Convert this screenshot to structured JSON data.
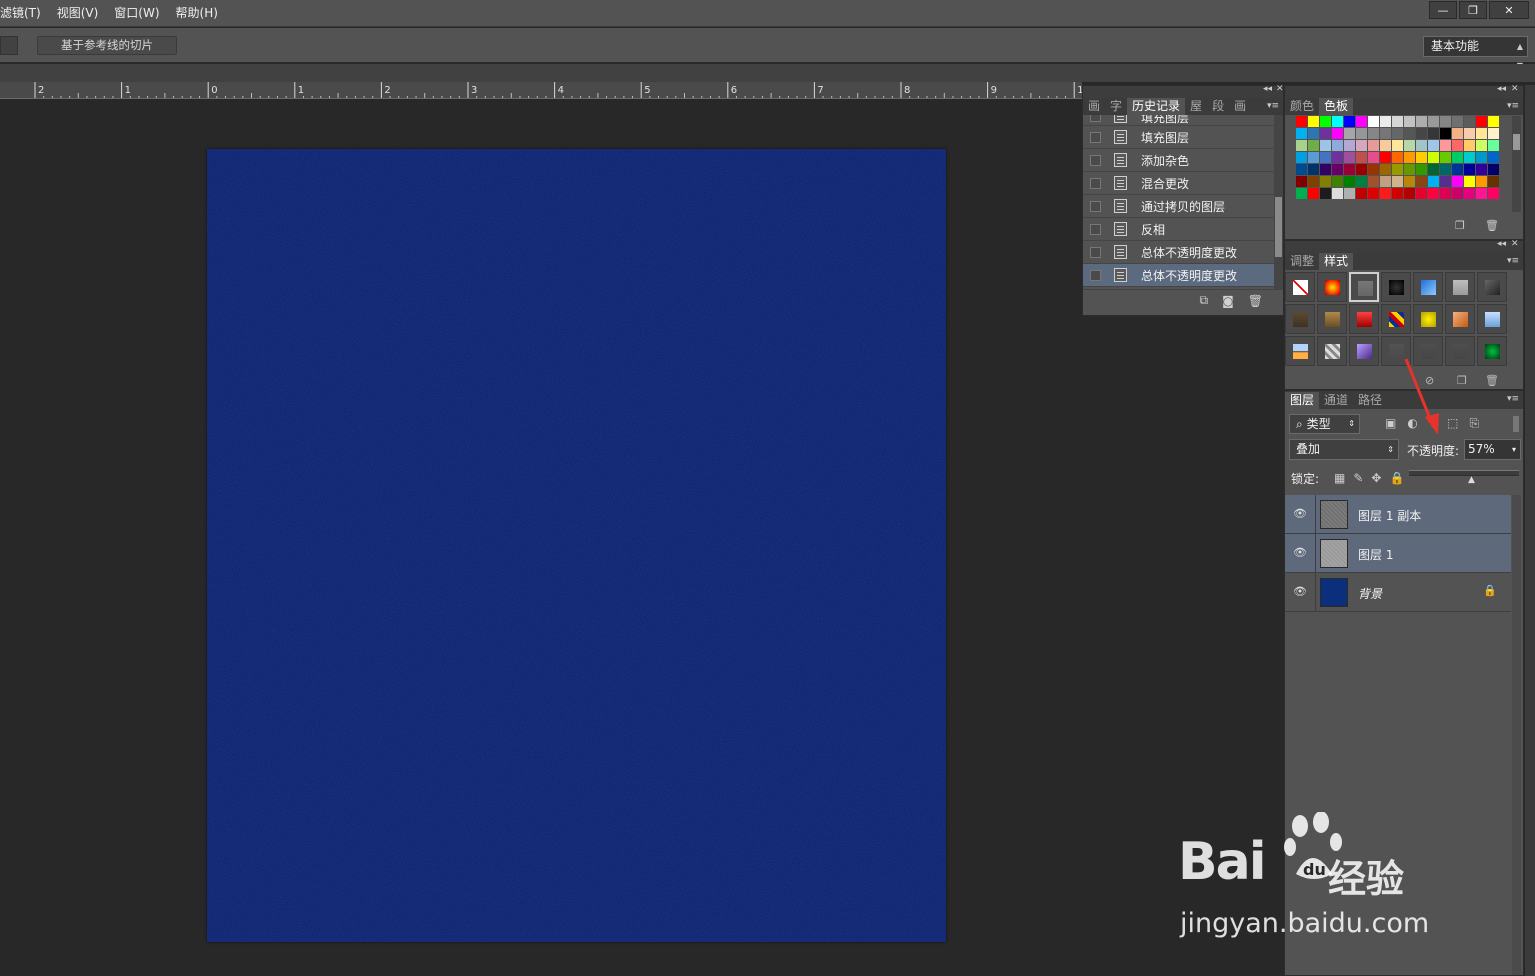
{
  "menubar": {
    "items": [
      "滤镜(T)",
      "视图(V)",
      "窗口(W)",
      "帮助(H)"
    ],
    "window_controls": [
      "—",
      "❐",
      "✕"
    ]
  },
  "options_bar": {
    "slice_button": "基于参考线的切片",
    "workspace": "基本功能"
  },
  "ruler": {
    "labels": [
      "2",
      "1",
      "0",
      "1",
      "2",
      "3",
      "4",
      "5",
      "6",
      "7",
      "8",
      "9",
      "1"
    ]
  },
  "history_panel": {
    "tabs": [
      "画",
      "字",
      "历史记录",
      "屋",
      "段",
      "画"
    ],
    "active_tab": "历史记录",
    "items": [
      {
        "label": "填充图层",
        "selected": false
      },
      {
        "label": "填充图层",
        "selected": false
      },
      {
        "label": "添加杂色",
        "selected": false
      },
      {
        "label": "混合更改",
        "selected": false
      },
      {
        "label": "通过拷贝的图层",
        "selected": false
      },
      {
        "label": "反相",
        "selected": false
      },
      {
        "label": "总体不透明度更改",
        "selected": false
      },
      {
        "label": "总体不透明度更改",
        "selected": true
      }
    ]
  },
  "swatches_panel": {
    "tabs": [
      "颜色",
      "色板"
    ],
    "active_tab": "色板"
  },
  "styles_panel": {
    "tabs": [
      "调整",
      "样式"
    ],
    "active_tab": "样式"
  },
  "layers_panel": {
    "tabs": [
      "图层",
      "通道",
      "路径"
    ],
    "active_tab": "图层",
    "kind_filter": "类型",
    "blend_mode": "叠加",
    "opacity_label": "不透明度:",
    "opacity_value": "57%",
    "opacity_level": 0.57,
    "lock_label": "锁定:",
    "layers": [
      {
        "name": "图层 1 副本",
        "selected": true,
        "thumb": "#707070",
        "locked": false
      },
      {
        "name": "图层 1",
        "selected": true,
        "thumb": "#9a9a9a",
        "locked": false
      },
      {
        "name": "背景",
        "selected": false,
        "thumb": "#0b2f7a",
        "locked": true
      }
    ]
  },
  "canvas": {
    "fill_color": "#0c1f6b"
  },
  "watermark": {
    "brand": "Bai",
    "brand_suffix": "du",
    "product": "经验",
    "url": "jingyan.baidu.com"
  },
  "colors": {
    "panel_bg": "#535353",
    "selection": "#5e6a7c",
    "annotation_arrow": "#e8322c"
  }
}
